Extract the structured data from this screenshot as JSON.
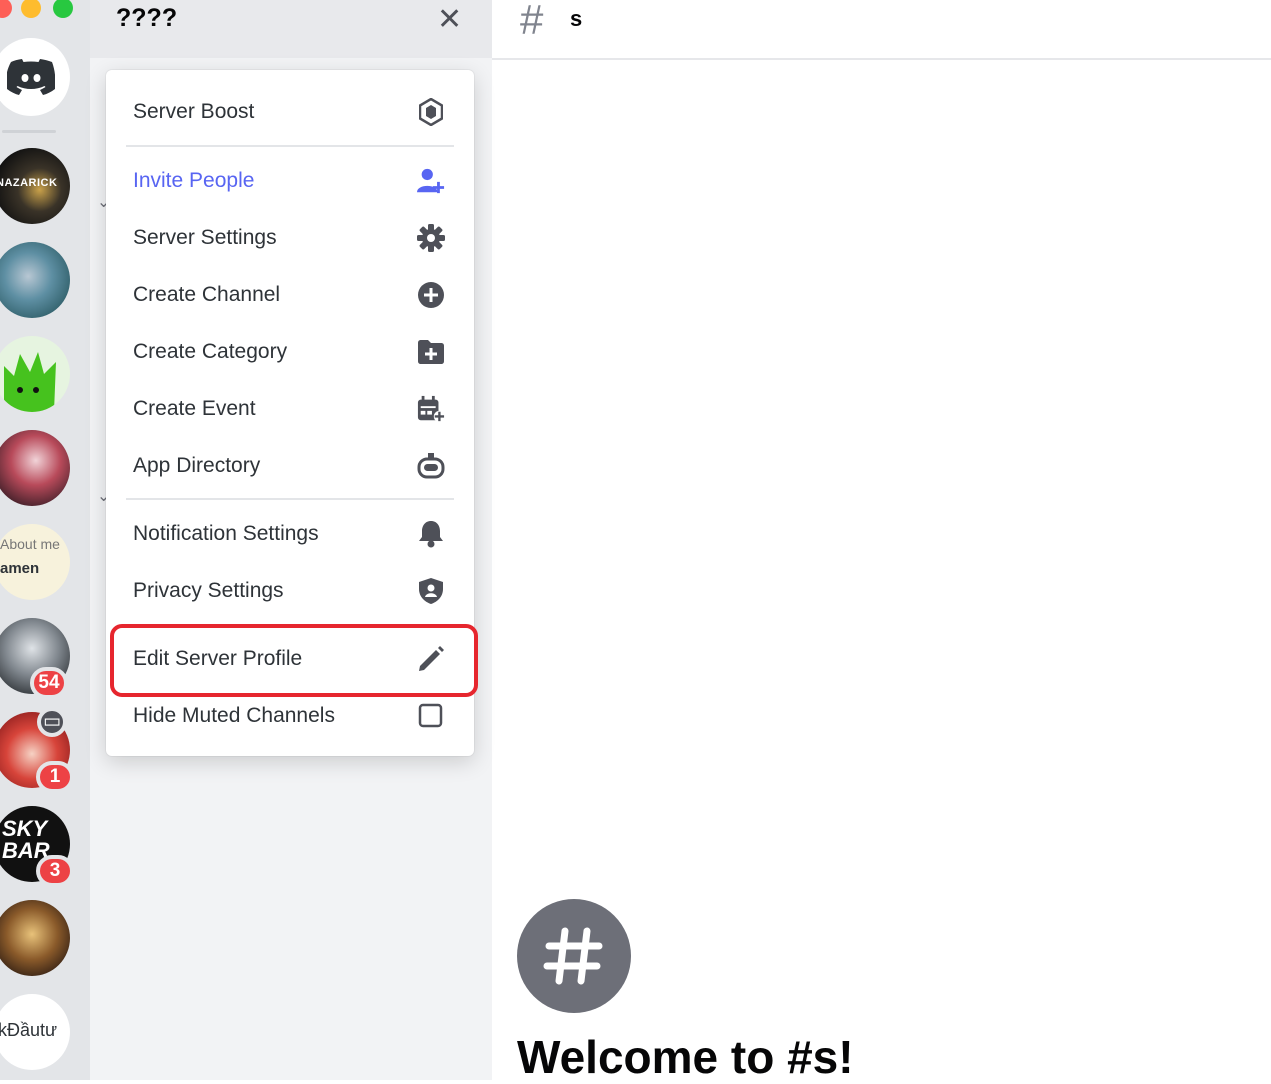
{
  "server": {
    "name": "????"
  },
  "rail": {
    "servers": [
      {
        "name": "NAZARICK"
      },
      {
        "name": ""
      },
      {
        "name": ""
      },
      {
        "name": ""
      },
      {
        "about_text": "About me",
        "name_text": "amen"
      },
      {
        "badge": "54"
      },
      {
        "badge": "1"
      },
      {
        "name": "SKY BAR",
        "badge": "3"
      },
      {
        "name": ""
      },
      {
        "name": "kĐầutư"
      }
    ]
  },
  "menu": {
    "items": [
      {
        "label": "Server Boost",
        "icon": "boost-icon"
      },
      {
        "label": "Invite People",
        "icon": "invite-icon",
        "color": "#5865f2"
      },
      {
        "label": "Server Settings",
        "icon": "gear-icon"
      },
      {
        "label": "Create Channel",
        "icon": "plus-circle-icon"
      },
      {
        "label": "Create Category",
        "icon": "folder-plus-icon"
      },
      {
        "label": "Create Event",
        "icon": "calendar-plus-icon"
      },
      {
        "label": "App Directory",
        "icon": "robot-icon"
      },
      {
        "label": "Notification Settings",
        "icon": "bell-icon"
      },
      {
        "label": "Privacy Settings",
        "icon": "shield-icon"
      },
      {
        "label": "Edit Server Profile",
        "icon": "pencil-icon"
      },
      {
        "label": "Hide Muted Channels",
        "icon": "checkbox-icon"
      }
    ]
  },
  "main": {
    "channel_name": "s",
    "welcome": "Welcome to #s!"
  },
  "colors": {
    "accent": "#5865f2",
    "badge": "#ed4245",
    "highlight": "#e6262e"
  }
}
